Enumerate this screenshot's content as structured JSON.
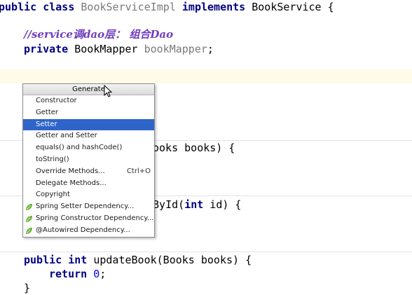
{
  "editor": {
    "line1": {
      "kw1": "public class ",
      "name": "BookServiceImpl",
      "kw2": " implements ",
      "iface": "BookService {"
    },
    "comment": "//service调dao层： 组合Dao",
    "field": {
      "kw": "private ",
      "type": "BookMapper ",
      "name": "bookMapper",
      "semi": ";"
    },
    "frag_add": "ooks books) {",
    "frag_query": {
      "pre": "kById(",
      "kw": "int",
      "post": " id) {"
    },
    "update": {
      "kw1": "public ",
      "kw2": "int",
      "rest": " updateBook(Books books) {"
    },
    "ret": {
      "kw": "return ",
      "num": "0",
      "semi": ";"
    },
    "close": "}"
  },
  "generate_menu": {
    "title": "Generate",
    "items": [
      {
        "label": "Constructor"
      },
      {
        "label": "Getter"
      },
      {
        "label": "Setter",
        "selected": true
      },
      {
        "label": "Getter and Setter"
      },
      {
        "label": "equals() and hashCode()"
      },
      {
        "label": "toString()"
      },
      {
        "label": "Override Methods...",
        "shortcut": "Ctrl+O"
      },
      {
        "label": "Delegate Methods..."
      },
      {
        "label": "Copyright"
      },
      {
        "label": "Spring Setter Dependency...",
        "icon": "spring-leaf-icon"
      },
      {
        "label": "Spring Constructor Dependency...",
        "icon": "spring-leaf-icon"
      },
      {
        "label": "@Autowired Dependency...",
        "icon": "spring-leaf-icon"
      }
    ]
  },
  "colors": {
    "keyword": "#000080",
    "comment": "#6f3ec0",
    "field": "#660e7a",
    "selection": "#2f65ca",
    "spring_leaf": "#6db33f"
  }
}
